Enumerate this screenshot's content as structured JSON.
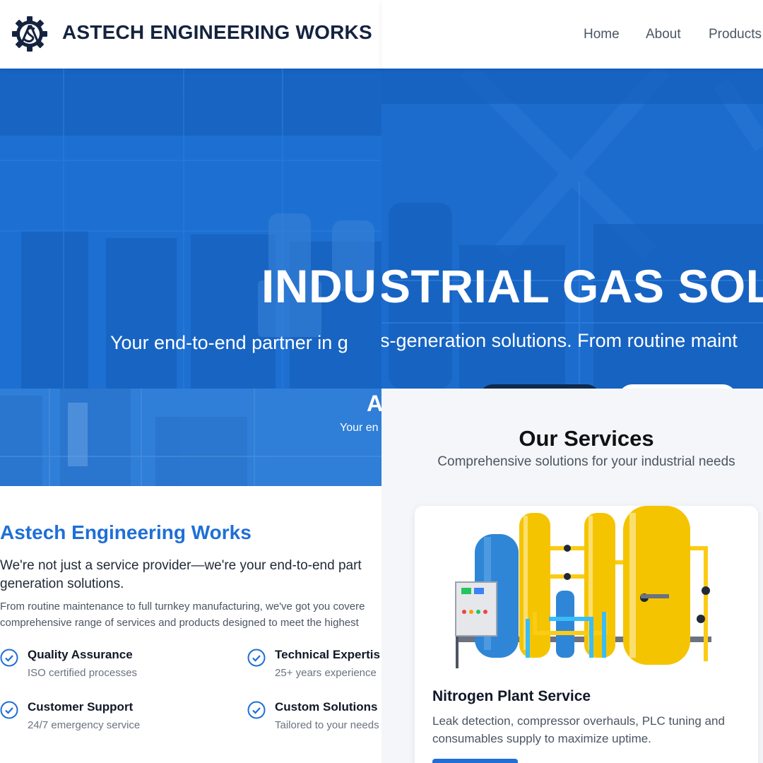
{
  "header": {
    "brand": "ASTECH ENGINEERING WORKS",
    "logo_icon": "gear-logo-icon",
    "nav": [
      "Home",
      "About",
      "Products"
    ]
  },
  "hero": {
    "title_left": "INDU",
    "title_right": "STRIAL GAS SOL",
    "subtitle_left": "Your end-to-end partner in g",
    "subtitle_right": "s-generation solutions. From routine maint"
  },
  "about_hero": {
    "title": "A",
    "subtitle": "Your en"
  },
  "about": {
    "title": "Astech Engineering Works",
    "lead": "We're not just a service provider—we're your end-to-end part\ngeneration solutions.",
    "body": "From routine maintenance to full turnkey manufacturing, we've got you covere\ncomprehensive range of services and products designed to meet the highest",
    "features": [
      {
        "title": "Quality Assurance",
        "desc": "ISO certified processes"
      },
      {
        "title": "Technical Expertis",
        "desc": "25+ years experience"
      },
      {
        "title": "Customer Support",
        "desc": "24/7 emergency service"
      },
      {
        "title": "Custom Solutions",
        "desc": "Tailored to your needs"
      }
    ]
  },
  "services": {
    "title": "Our Services",
    "subtitle": "Comprehensive solutions for your industrial needs",
    "cards": [
      {
        "title": "Nitrogen Plant Service",
        "desc": "Leak detection, compressor overhauls, PLC tuning and consumables supply to maximize uptime."
      }
    ]
  },
  "colors": {
    "brand_blue": "#1f6fd6",
    "hero_blue": "#1c6cce",
    "navy": "#14233f",
    "tank_yellow": "#f5c400",
    "tank_blue": "#2f86d6"
  }
}
